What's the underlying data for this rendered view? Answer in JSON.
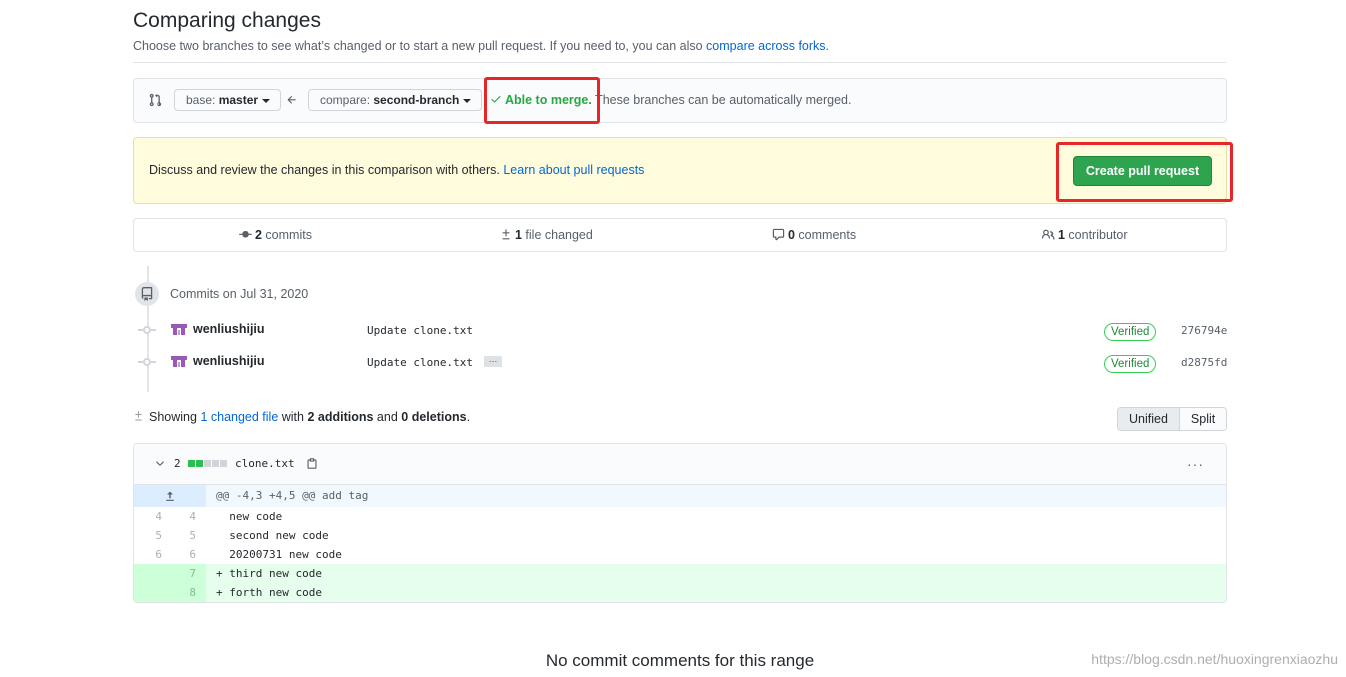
{
  "header": {
    "title": "Comparing changes",
    "description": "Choose two branches to see what’s changed or to start a new pull request. If you need to, you can also ",
    "description_link": "compare across forks."
  },
  "compare_bar": {
    "base_label": "base: ",
    "base_branch": "master",
    "compare_label": "compare: ",
    "compare_branch": "second-branch",
    "merge_ok": "Able to merge.",
    "merge_detail": " These branches can be automatically merged."
  },
  "flash": {
    "text": "Discuss and review the changes in this comparison with others. ",
    "link": "Learn about pull requests",
    "create_button": "Create pull request"
  },
  "stats": {
    "commits_count": "2",
    "commits_label": " commits",
    "files_count": "1",
    "files_label": " file changed",
    "comments_count": "0",
    "comments_label": " comments",
    "contributors_count": "1",
    "contributors_label": " contributor"
  },
  "commits": {
    "date_heading": "Commits on Jul 31, 2020",
    "items": [
      {
        "author": "wenliushijiu",
        "message": "Update clone.txt",
        "verified": "Verified",
        "sha": "276794e",
        "has_more": false
      },
      {
        "author": "wenliushijiu",
        "message": "Update clone.txt",
        "verified": "Verified",
        "sha": "d2875fd",
        "has_more": true
      }
    ],
    "ellipsis": "…"
  },
  "diff_summary": {
    "prefix": "Showing ",
    "changed_files_link": "1 changed file",
    "mid": " with ",
    "additions": "2 additions",
    "and": " and ",
    "deletions": "0 deletions",
    "suffix": ".",
    "view_unified": "Unified",
    "view_split": "Split"
  },
  "file_diff": {
    "change_count": "2",
    "file_name": "clone.txt",
    "menu": "···",
    "hunk_header": "@@ -4,3 +4,5 @@ add tag",
    "lines": [
      {
        "old": "4",
        "new": "4",
        "type": "context",
        "text": "  new code"
      },
      {
        "old": "5",
        "new": "5",
        "type": "context",
        "text": "  second new code"
      },
      {
        "old": "6",
        "new": "6",
        "type": "context",
        "text": "  20200731 new code"
      },
      {
        "old": "",
        "new": "7",
        "type": "add",
        "text": "+ third new code"
      },
      {
        "old": "",
        "new": "8",
        "type": "add",
        "text": "+ forth new code"
      }
    ]
  },
  "footer": {
    "no_comments": "No commit comments for this range",
    "watermark": "https://blog.csdn.net/huoxingrenxiaozhu"
  },
  "colors": {
    "accent_link": "#0366d6",
    "success": "#2ea44f",
    "flash_bg": "#fffbdd",
    "annotation": "#e52727"
  }
}
